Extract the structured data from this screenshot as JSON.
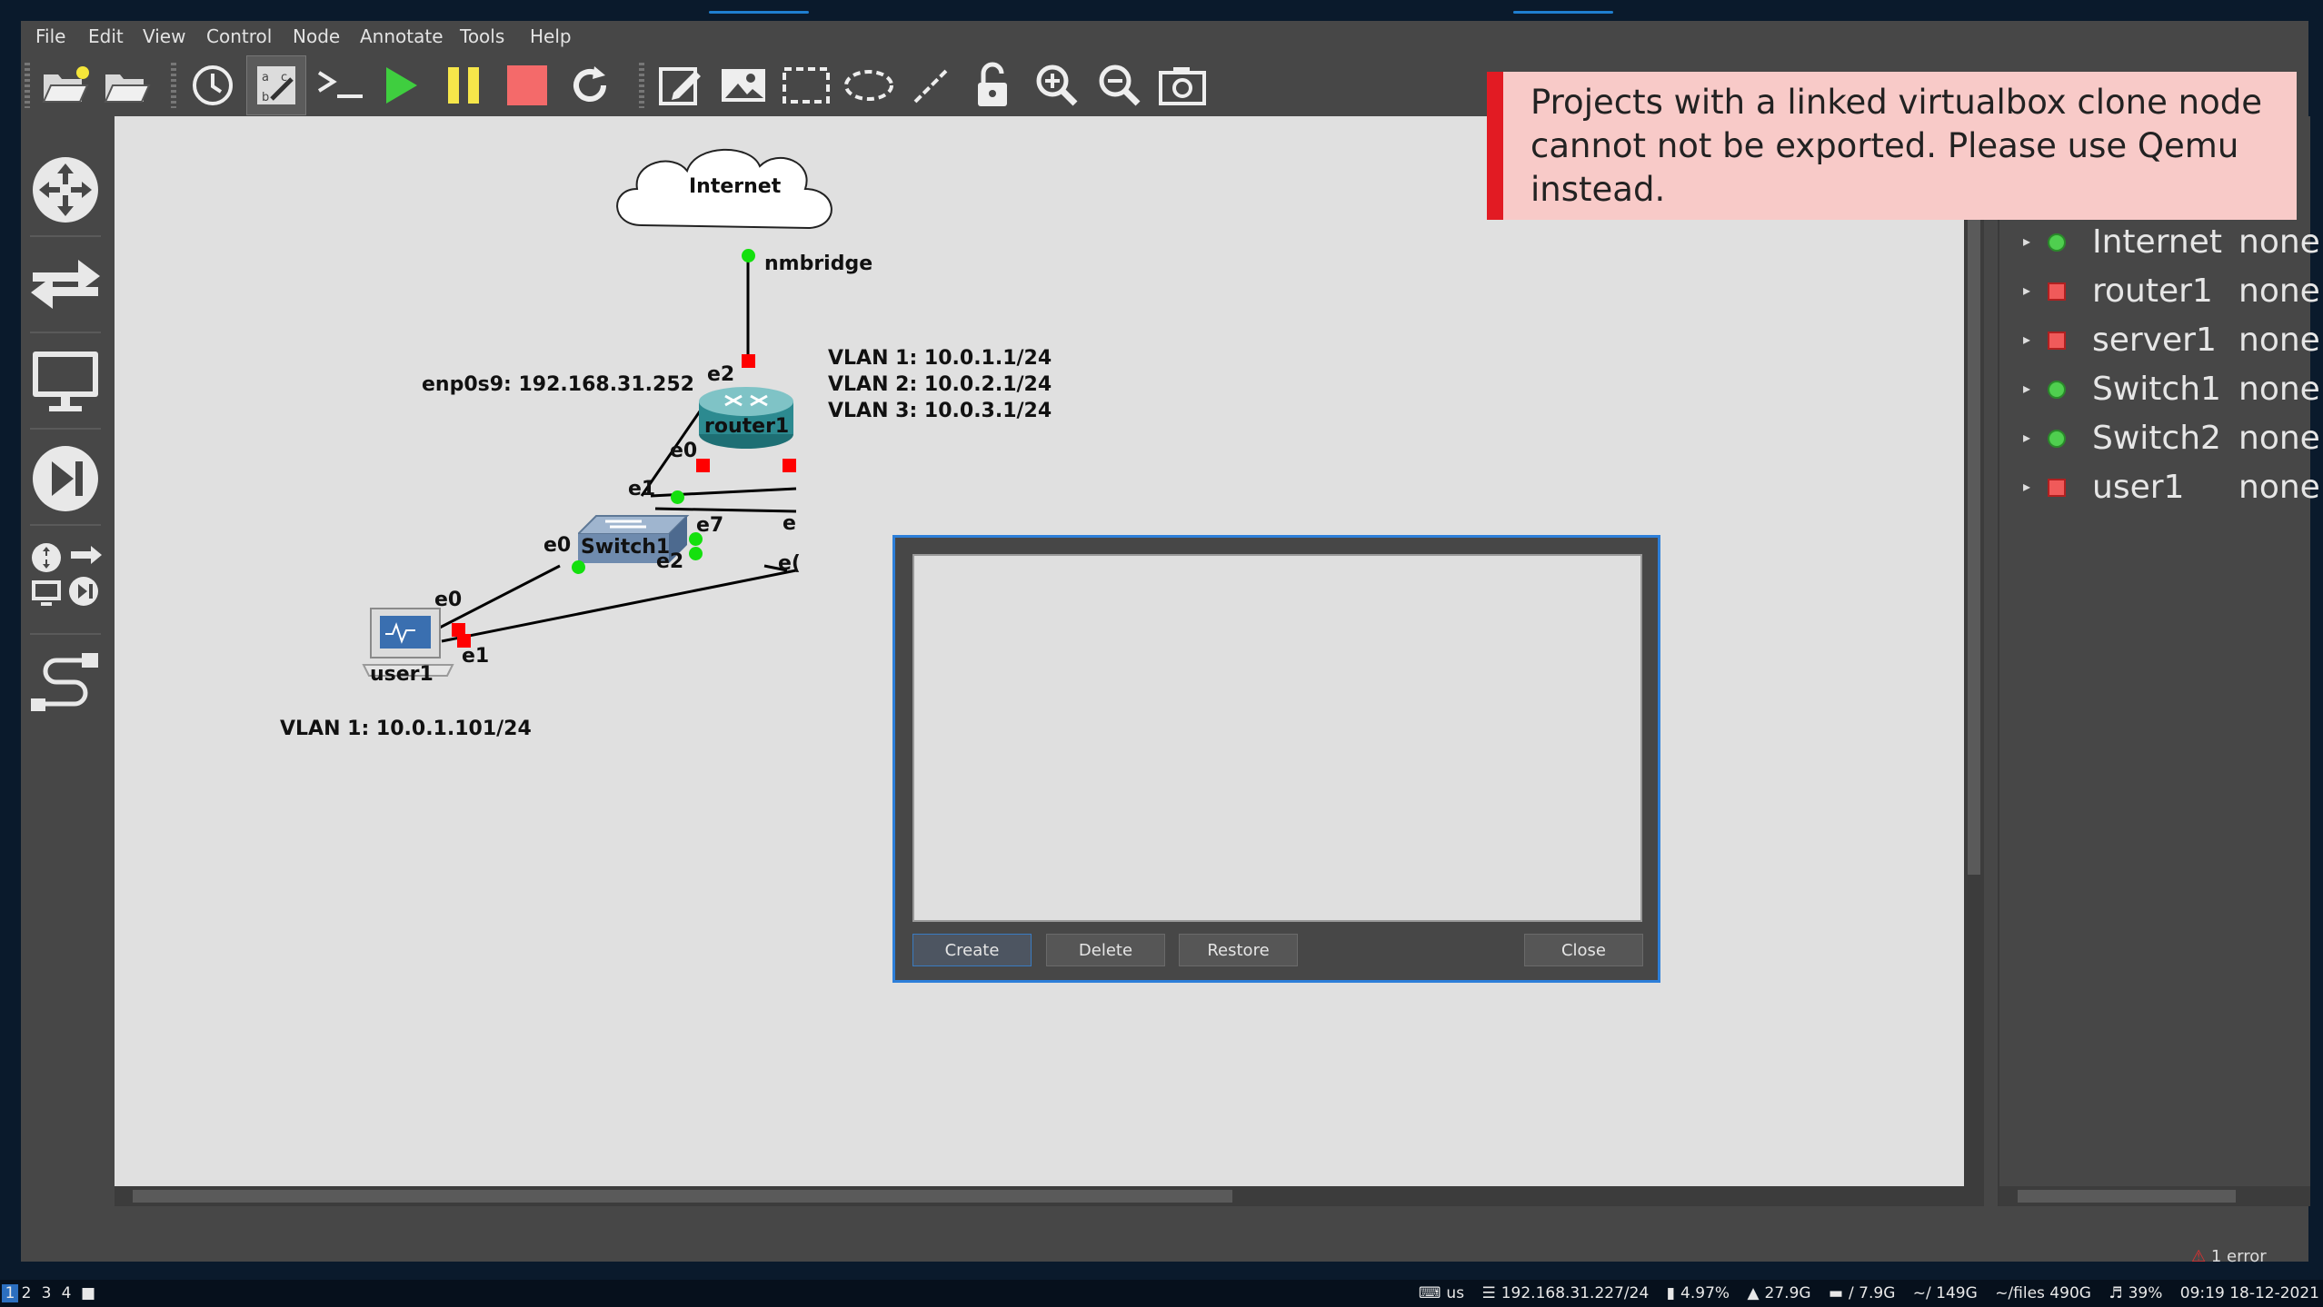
{
  "menu": [
    "File",
    "Edit",
    "View",
    "Control",
    "Node",
    "Annotate",
    "Tools",
    "Help"
  ],
  "toolbar": [
    "open-project",
    "open-folder",
    "snapshot-clock",
    "show-interface-labels",
    "console-all",
    "start-all",
    "suspend-all",
    "stop-all",
    "reload-all",
    "add-note",
    "insert-picture",
    "draw-rectangle",
    "draw-ellipse",
    "draw-line",
    "lock-items",
    "zoom-in",
    "zoom-out",
    "screenshot"
  ],
  "dock": [
    "browse-routers",
    "browse-switches",
    "browse-end-devices",
    "browse-security-devices",
    "browse-all-devices",
    "add-link"
  ],
  "topology": {
    "cloud_label": "Internet",
    "cloud_port": "nmbridge",
    "router_label": "router1",
    "router_note": "enp0s9: 192.168.31.252",
    "router_vlans": [
      "VLAN 1: 10.0.1.1/24",
      "VLAN 2: 10.0.2.1/24",
      "VLAN 3: 10.0.3.1/24"
    ],
    "switch_label": "Switch1",
    "user_label": "user1",
    "user_note": "VLAN 1: 10.0.1.101/24",
    "ports": {
      "e2": "e2",
      "e0": "e0",
      "e1": "e1",
      "e7": "e7",
      "e0b": "e0",
      "e2b": "e2",
      "e0c": "e0",
      "e1c": "e1",
      "e_partial": "e",
      "e0_partial": "e("
    }
  },
  "notification": {
    "text": "Projects with a linked virtualbox clone node cannot not be exported. Please use Qemu instead.",
    "accent": "#e21b23"
  },
  "nodes_summary": [
    {
      "name": "Internet",
      "status": "none",
      "state": "green"
    },
    {
      "name": "router1",
      "status": "none",
      "state": "red"
    },
    {
      "name": "server1",
      "status": "none",
      "state": "red"
    },
    {
      "name": "Switch1",
      "status": "none",
      "state": "green"
    },
    {
      "name": "Switch2",
      "status": "none",
      "state": "green"
    },
    {
      "name": "user1",
      "status": "none",
      "state": "red"
    }
  ],
  "dialog": {
    "create": "Create",
    "delete": "Delete",
    "restore": "Restore",
    "close": "Close"
  },
  "status": {
    "errors": "1 error"
  },
  "taskbar": {
    "workspaces": [
      "1",
      "2",
      "3",
      "4"
    ],
    "keyboard": "us",
    "network": "192.168.31.227/24",
    "cpu": "4.97%",
    "memory": "27.9G",
    "swap": "/ 7.9G",
    "disk_root": "~/ 149G",
    "disk_files": "~/files 490G",
    "volume": "39%",
    "clock": "09:19 18-12-2021"
  }
}
